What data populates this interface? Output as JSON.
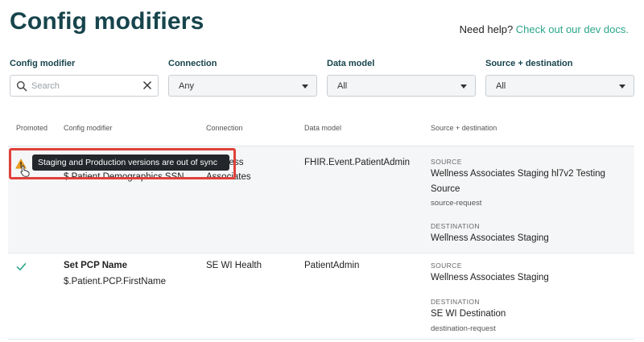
{
  "page": {
    "title": "Config modifiers",
    "help_prefix": "Need help?",
    "help_link": "Check out our dev docs."
  },
  "filters": {
    "config_modifier": {
      "label": "Config modifier",
      "placeholder": "Search",
      "value": ""
    },
    "connection": {
      "label": "Connection",
      "selected": "Any"
    },
    "data_model": {
      "label": "Data model",
      "selected": "All"
    },
    "source_destination": {
      "label": "Source + destination",
      "selected": "All"
    }
  },
  "table": {
    "headers": [
      "Promoted",
      "Config modifier",
      "Connection",
      "Data model",
      "Source + destination"
    ],
    "rows": [
      {
        "promoted": "warning",
        "name": "",
        "path": "$.Patient.Demographics.SSN",
        "connection_line1": "Wellness",
        "connection_line2": "Associates",
        "data_model": "FHIR.Event.PatientAdmin",
        "source_label": "SOURCE",
        "source_line1": "Wellness Associates Staging hl7v2 Testing",
        "source_line2": "Source",
        "source_sub": "source-request",
        "destination_label": "DESTINATION",
        "destination_name": "Wellness Associates Staging",
        "destination_sub": ""
      },
      {
        "promoted": "check",
        "name": "Set PCP Name",
        "path": "$.Patient.PCP.FirstName",
        "connection_line1": "SE WI Health",
        "connection_line2": "",
        "data_model": "PatientAdmin",
        "source_label": "SOURCE",
        "source_line1": "Wellness Associates Staging",
        "source_line2": "",
        "source_sub": "",
        "destination_label": "DESTINATION",
        "destination_name": "SE WI Destination",
        "destination_sub": "destination-request"
      }
    ]
  },
  "tooltip": {
    "text": "Staging and Production versions are out of sync"
  },
  "icons": {
    "warning": "warning-icon",
    "check": "check-icon",
    "search": "search-icon",
    "clear": "close-icon",
    "dropdown": "chevron-down-icon",
    "pointer": "cursor-hand-icon"
  },
  "colors": {
    "title": "#17444c",
    "link": "#2ba58a",
    "warning": "#f0a020",
    "check": "#2ba58a",
    "highlight_frame": "#e0413a",
    "tooltip_bg": "#23272b",
    "row_highlight": "#f5f6f7"
  }
}
